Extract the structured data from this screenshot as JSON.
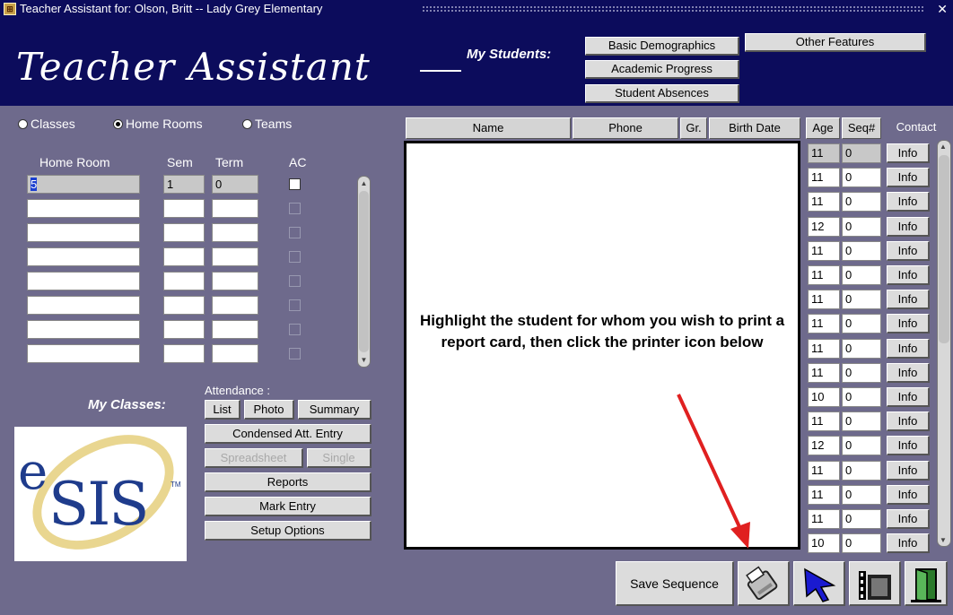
{
  "window": {
    "title": "Teacher Assistant for: Olson, Britt -- Lady Grey Elementary",
    "close_glyph": "✕"
  },
  "header": {
    "app_title": "Teacher Assistant",
    "my_students_label": "My Students:",
    "buttons": {
      "basic_demographics": "Basic Demographics",
      "academic_progress": "Academic Progress",
      "student_absences": "Student Absences",
      "other_features": "Other Features"
    }
  },
  "view_options": {
    "classes": "Classes",
    "home_rooms": "Home Rooms",
    "teams": "Teams",
    "selected": "Home Rooms"
  },
  "homeroom_table": {
    "headers": {
      "home_room": "Home Room",
      "sem": "Sem",
      "term": "Term",
      "ac": "AC"
    },
    "rows": [
      {
        "home_room": "5",
        "sem": "1",
        "term": "0"
      },
      {
        "home_room": "",
        "sem": "",
        "term": ""
      },
      {
        "home_room": "",
        "sem": "",
        "term": ""
      },
      {
        "home_room": "",
        "sem": "",
        "term": ""
      },
      {
        "home_room": "",
        "sem": "",
        "term": ""
      },
      {
        "home_room": "",
        "sem": "",
        "term": ""
      },
      {
        "home_room": "",
        "sem": "",
        "term": ""
      },
      {
        "home_room": "",
        "sem": "",
        "term": ""
      }
    ]
  },
  "my_classes": {
    "label": "My Classes:",
    "attendance_label": "Attendance :",
    "buttons": {
      "list": "List",
      "photo": "Photo",
      "summary": "Summary",
      "condensed": "Condensed Att. Entry",
      "spreadsheet": "Spreadsheet",
      "single": "Single",
      "reports": "Reports",
      "mark_entry": "Mark Entry",
      "setup_options": "Setup Options"
    },
    "logo": {
      "e": "e",
      "sis": "SIS",
      "tm": "TM"
    }
  },
  "student_table": {
    "headers": {
      "name": "Name",
      "phone": "Phone",
      "gr": "Gr.",
      "birth_date": "Birth Date",
      "age": "Age",
      "seq": "Seq#",
      "contact": "Contact"
    },
    "instruction": "Highlight the student for whom you wish to print a report card, then click the printer icon below",
    "info_label": "Info",
    "rows": [
      {
        "age": "11",
        "seq": "0"
      },
      {
        "age": "11",
        "seq": "0"
      },
      {
        "age": "11",
        "seq": "0"
      },
      {
        "age": "12",
        "seq": "0"
      },
      {
        "age": "11",
        "seq": "0"
      },
      {
        "age": "11",
        "seq": "0"
      },
      {
        "age": "11",
        "seq": "0"
      },
      {
        "age": "11",
        "seq": "0"
      },
      {
        "age": "11",
        "seq": "0"
      },
      {
        "age": "11",
        "seq": "0"
      },
      {
        "age": "10",
        "seq": "0"
      },
      {
        "age": "11",
        "seq": "0"
      },
      {
        "age": "12",
        "seq": "0"
      },
      {
        "age": "11",
        "seq": "0"
      },
      {
        "age": "11",
        "seq": "0"
      },
      {
        "age": "11",
        "seq": "0"
      },
      {
        "age": "10",
        "seq": "0"
      }
    ]
  },
  "toolbar": {
    "save_sequence": "Save Sequence",
    "icons": [
      "printer-icon",
      "pointer-icon",
      "film-icon",
      "exit-door-icon"
    ]
  },
  "colors": {
    "header_bg": "#0c0c5c",
    "panel_bg": "#6e6a8c",
    "button_bg": "#dcdcdc",
    "annotation_arrow": "#e02020"
  }
}
